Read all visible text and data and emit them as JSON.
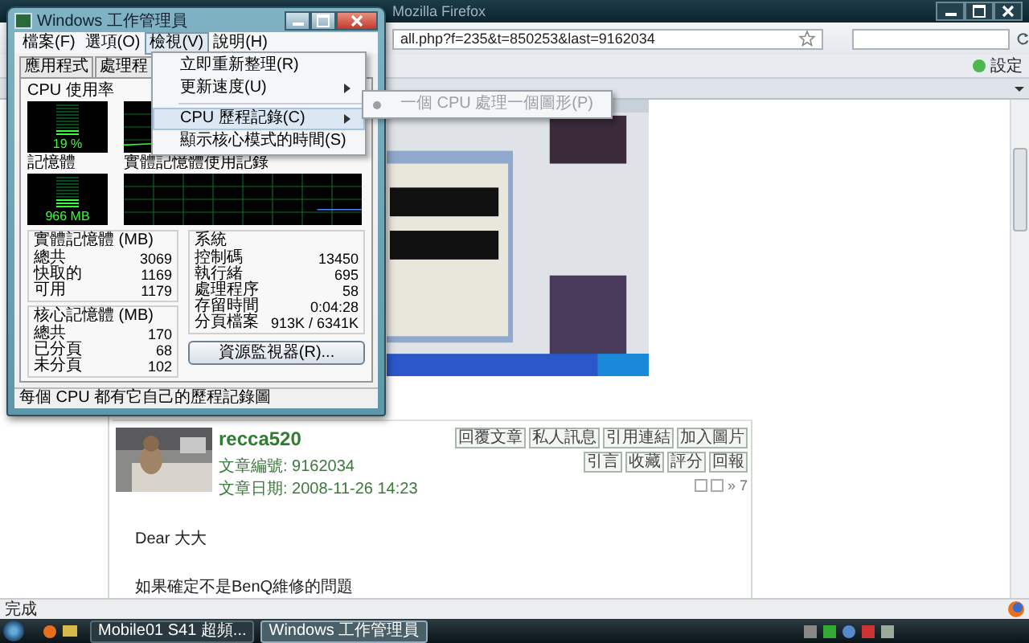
{
  "firefox": {
    "title": "Mozilla Firefox",
    "address": "all.php?f=235&t=850253&last=9162034",
    "bookmarks_button": "設定",
    "post": {
      "author": "recca520",
      "actions": [
        "回覆文章",
        "私人訊息",
        "引用連結",
        "加入圖片",
        "引言",
        "收藏",
        "評分",
        "回報"
      ],
      "post_number": "» 7",
      "meta": [
        {
          "label": "文章編號:",
          "value": "9162034"
        },
        {
          "label": "文章日期:",
          "value": "2008-11-26 14:23"
        }
      ],
      "body": [
        "Dear 大大",
        "如果確定不是BenQ維修的問題"
      ]
    },
    "status_bar": "完成"
  },
  "task_manager": {
    "title": "Windows 工作管理員",
    "menu": [
      {
        "label": "檔案(F)",
        "selected": false
      },
      {
        "label": "選項(O)",
        "selected": false
      },
      {
        "label": "檢視(V)",
        "selected": true
      },
      {
        "label": "說明(H)",
        "selected": false
      }
    ],
    "tabs": [
      {
        "label": "應用程式",
        "selected": false
      },
      {
        "label": "處理程",
        "selected": false
      }
    ],
    "cpu_usage": {
      "label": "CPU 使用率",
      "reading": "19 %",
      "level": 0.19
    },
    "memory": {
      "label": "記憶體",
      "reading": "966 MB",
      "level": 0.31
    },
    "memory_history": {
      "label": "實體記憶體使用記錄"
    },
    "physical_memory": {
      "title": "實體記憶體 (MB)",
      "rows": [
        {
          "name": "總共",
          "value": "3069"
        },
        {
          "name": "快取的",
          "value": "1169"
        },
        {
          "name": "可用",
          "value": "1179"
        }
      ]
    },
    "kernel_memory": {
      "title": "核心記憶體 (MB)",
      "rows": [
        {
          "name": "總共",
          "value": "170"
        },
        {
          "name": "已分頁",
          "value": "68"
        },
        {
          "name": "未分頁",
          "value": "102"
        }
      ]
    },
    "system": {
      "title": "系統",
      "rows": [
        {
          "name": "控制碼",
          "value": "13450"
        },
        {
          "name": "執行緒",
          "value": "695"
        },
        {
          "name": "處理程序",
          "value": "58"
        },
        {
          "name": "存留時間",
          "value": "0:04:28"
        },
        {
          "name": "分頁檔案",
          "value": "913K / 6341K"
        }
      ]
    },
    "resource_monitor_button": "資源監視器(R)...",
    "status": "每個 CPU 都有它自己的歷程記錄圖"
  },
  "view_menu": {
    "items": [
      {
        "kind": "item",
        "label": "立即重新整理(R)",
        "submenu": false,
        "selected": false
      },
      {
        "kind": "item",
        "label": "更新速度(U)",
        "submenu": true,
        "selected": false
      },
      {
        "kind": "separator"
      },
      {
        "kind": "item",
        "label": "CPU 歷程記錄(C)",
        "submenu": true,
        "selected": true
      },
      {
        "kind": "item",
        "label": "顯示核心模式的時間(S)",
        "submenu": false,
        "selected": false
      }
    ]
  },
  "submenu": {
    "items": [
      {
        "label": "一個 CPU 處理一個圖形(P)",
        "checked": true,
        "disabled": true
      }
    ]
  },
  "taskbar": {
    "buttons": [
      {
        "label": "Mobile01 S41 超頻...",
        "selected": false
      },
      {
        "label": "Windows 工作管理員",
        "selected": true
      }
    ]
  }
}
